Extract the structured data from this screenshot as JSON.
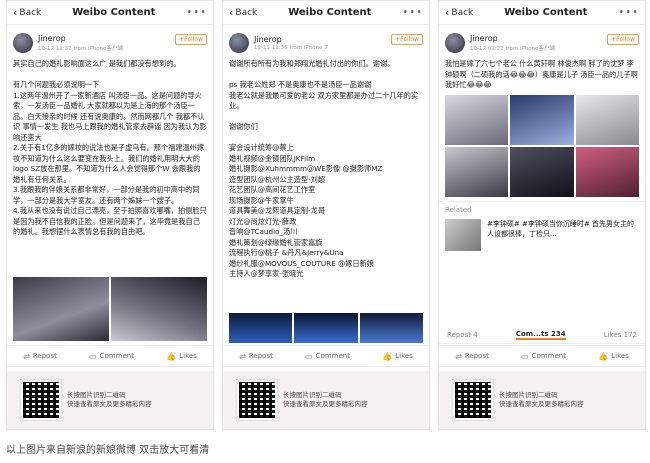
{
  "nav": {
    "back_label": "Back",
    "title": "Weibo Content",
    "more": "•••"
  },
  "user": {
    "name": "Jinerop",
    "follow_label": "+Follow"
  },
  "posts": [
    {
      "meta": "10-12 12:37  from iPhone客户端",
      "text": "其实自己的婚礼影响面这么广 是我们都没有想到的。\n\n有几个问题我必须说明一下\n1.这两年温州开了一家新酒店 叫汤臣一品。这是问题的导火索，一发汤臣一品婚礼 大家就都以为是上海的那个汤臣一品。白天接亲的时候 还有说奥康的。然而网都几个 我都不认识 事情一发生 我也马上跟我的婚礼管家去辟谣 因为我认为影响还蛮大\n2.关于有1亿多的嫁妆的说法也是子虚乌有。那个福建温州嫁妆不知道为什么这么要变在我头上。我们的婚礼用明大大的logo SZ放在那里。不知道为什么人会觉得那个W 会跟我的婚礼有任何关系。\n3.我跟我的伴娘关系都非常好，一部分是我的初中高中的同学，一部分是我大学室友。还有两个姊妹一个嫂子。\n4.我从来也没有说过自己漂亮，至于拍照喜欢嘟嘴，拍侧脸只是因为我不自信我的正脸。但是问题来了，这毕竟是我自己的婚礼。我想摆什么表情总有我的自由吧。"
    },
    {
      "meta": "10-11 13:35  from iPhone 7",
      "text": "谢谢所有所有为我和郑翔光婚礼付出的你们。谢谢。\n\nps 我老公姓郑 不是奥康也不是汤臣一品谢谢\n我老公就是我最可爱的老公 双方家里都是办过二十几年的实业。\n\n谢谢你们\n\n宴会设计统筹@蔡上\n婚礼视频@金镜团队JKFilm\n婚礼摄影@Xuhmmmm@WE影像 @摄影师MZ\n造型团队@杭州公主造型-刘超\n花艺团队@高间花艺工作室\n现场摄影@牛家掌牛\n道具舞美@龙熙道具定制-龙哥\n灯光@尚炫灯光-薛政\n音响@TCaudio_汤川\n婚礼策划@绿缘婚礼管家嘉旋\n流程执行@桃子 &丹凡&Jerry&Una\n婚纱礼服@MOVOUS_COUTURE @嫁日新娘\n主持人@梦享家-张晓光"
    },
    {
      "meta": "10-12 01:22  from iPhone客户端",
      "text": "我怕是嫁了六七个老公 什么黄轩啊 林俊杰啊 胖了的沈梦 李钟硕啊（二硕我的话😂😂😂）奥康是儿子 汤臣一品的儿子啊 我好忙😂😂😂",
      "related_label": "Related",
      "related_text": "#李钟硕# #李钟硕当你沉睡时# 首先男女主的人设都很棒，丁检只..."
    }
  ],
  "actions": {
    "repost": "Repost",
    "comment": "Comment",
    "likes": "Likes"
  },
  "counts": {
    "repost": "Repost 4",
    "comments": "Com...ts 234",
    "likes": "Likes 172"
  },
  "qr": {
    "line1": "长按图片识别二维码",
    "line2": "快速查看原文及更多精彩内容"
  },
  "caption": "以上图片来自新浪的新娘微博  双击放大可看清"
}
